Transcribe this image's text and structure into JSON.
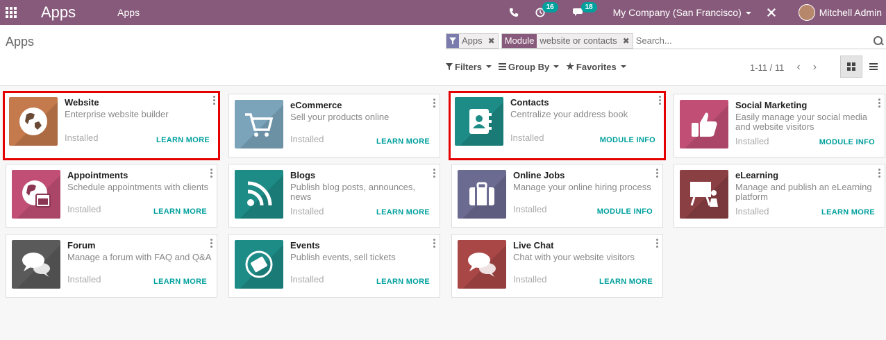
{
  "navbar": {
    "brand": "Apps",
    "menu": "Apps",
    "activity_count": "16",
    "message_count": "18",
    "company": "My Company (San Francisco)",
    "user": "Mitchell Admin"
  },
  "control": {
    "breadcrumb": "Apps",
    "facets": [
      {
        "label": "",
        "value": "Apps"
      },
      {
        "label": "Module",
        "value": "website or contacts"
      }
    ],
    "search_placeholder": "Search...",
    "filters": "Filters",
    "group_by": "Group By",
    "favorites": "Favorites",
    "pager": "1-11 / 11"
  },
  "colors": {
    "navbar": "#875a7b",
    "accent": "#00a09d",
    "highlight": "#e50000"
  },
  "apps": [
    {
      "name": "Website",
      "desc": "Enterprise website builder",
      "status": "Installed",
      "action": "LEARN MORE",
      "icon": "globe-icon",
      "color": "#c47a4c"
    },
    {
      "name": "eCommerce",
      "desc": "Sell your products online",
      "status": "Installed",
      "action": "LEARN MORE",
      "icon": "cart-icon",
      "color": "#7ba4bb"
    },
    {
      "name": "Contacts",
      "desc": "Centralize your address book",
      "status": "Installed",
      "action": "MODULE INFO",
      "icon": "address-book-icon",
      "color": "#1d8b86"
    },
    {
      "name": "Social Marketing",
      "desc": "Easily manage your social media and website visitors",
      "status": "Installed",
      "action": "MODULE INFO",
      "icon": "thumbs-up-icon",
      "color": "#c14f75"
    },
    {
      "name": "Appointments",
      "desc": "Schedule appointments with clients",
      "status": "Installed",
      "action": "LEARN MORE",
      "icon": "globe-calendar-icon",
      "color": "#c14f75"
    },
    {
      "name": "Blogs",
      "desc": "Publish blog posts, announces, news",
      "status": "Installed",
      "action": "LEARN MORE",
      "icon": "rss-icon",
      "color": "#1d8b86"
    },
    {
      "name": "Online Jobs",
      "desc": "Manage your online hiring process",
      "status": "Installed",
      "action": "MODULE INFO",
      "icon": "briefcase-icon",
      "color": "#6b6a91"
    },
    {
      "name": "eLearning",
      "desc": "Manage and publish an eLearning platform",
      "status": "Installed",
      "action": "LEARN MORE",
      "icon": "presentation-icon",
      "color": "#8a3f43"
    },
    {
      "name": "Forum",
      "desc": "Manage a forum with FAQ and Q&A",
      "status": "Installed",
      "action": "LEARN MORE",
      "icon": "chat-bubbles-icon",
      "color": "#5a5a5a"
    },
    {
      "name": "Events",
      "desc": "Publish events, sell tickets",
      "status": "Installed",
      "action": "LEARN MORE",
      "icon": "ticket-icon",
      "color": "#1d8b86"
    },
    {
      "name": "Live Chat",
      "desc": "Chat with your website visitors",
      "status": "Installed",
      "action": "LEARN MORE",
      "icon": "chat-bubbles-icon",
      "color": "#a94747"
    }
  ]
}
